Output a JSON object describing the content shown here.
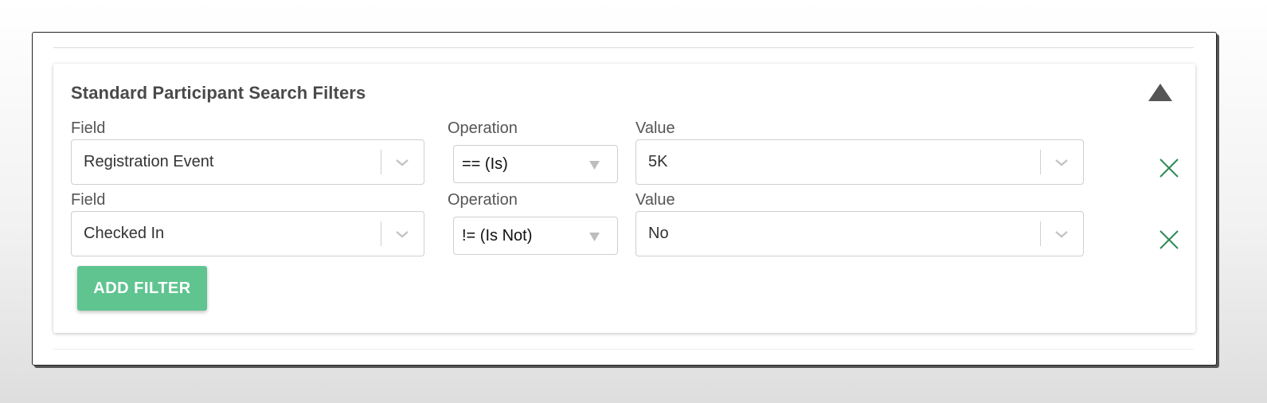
{
  "panel": {
    "title": "Standard Participant Search Filters",
    "collapse_icon": "triangle-up-icon"
  },
  "filters": [
    {
      "field_label": "Field",
      "field_value": "Registration Event",
      "operation_label": "Operation",
      "operation_value": "== (Is)",
      "value_label": "Value",
      "value_value": "5K"
    },
    {
      "field_label": "Field",
      "field_value": "Checked In",
      "operation_label": "Operation",
      "operation_value": "!= (Is Not)",
      "value_label": "Value",
      "value_value": "No"
    }
  ],
  "add_filter_label": "ADD FILTER",
  "colors": {
    "accent_green": "#5fc490",
    "remove_icon_green": "#2e8b57",
    "title_text": "#4a4a4a"
  }
}
